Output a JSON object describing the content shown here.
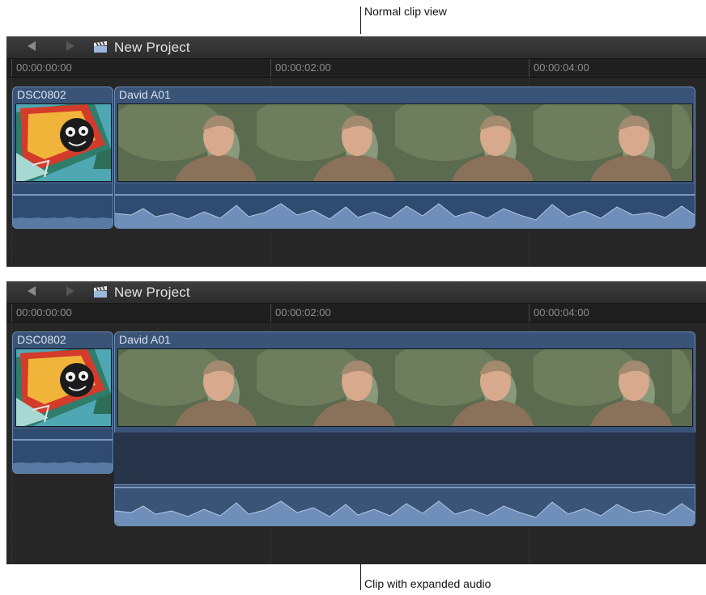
{
  "callouts": {
    "top": "Normal clip view",
    "bottom": "Clip with expanded audio"
  },
  "views": [
    {
      "toolbar": {
        "back_icon": "triangle-left-icon",
        "forward_icon": "triangle-right-icon",
        "project_icon": "clapperboard-icon",
        "project_name": "New Project"
      },
      "ruler": [
        "00:00:00:00",
        "00:00:02:00",
        "00:00:04:00"
      ],
      "clips": [
        {
          "name": "DSC0802"
        },
        {
          "name": "David A01"
        }
      ],
      "audio_state": "normal"
    },
    {
      "toolbar": {
        "back_icon": "triangle-left-icon",
        "forward_icon": "triangle-right-icon",
        "project_icon": "clapperboard-icon",
        "project_name": "New Project"
      },
      "ruler": [
        "00:00:00:00",
        "00:00:02:00",
        "00:00:04:00"
      ],
      "clips": [
        {
          "name": "DSC0802"
        },
        {
          "name": "David A01"
        }
      ],
      "audio_state": "expanded"
    }
  ],
  "colors": {
    "clip_fill": "#3a5478",
    "clip_border": "#6c89b0",
    "panel_bg": "#262626",
    "waveform": "#9cb5d6"
  }
}
